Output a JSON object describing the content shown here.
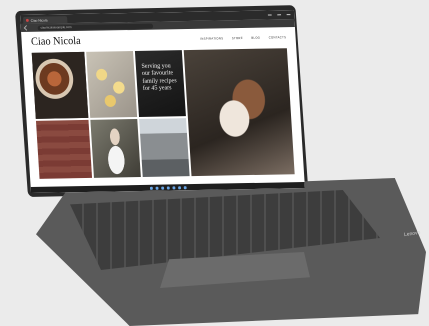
{
  "browser": {
    "tab_title": "Ciao Nicola",
    "url": "ciaonicolaexample.com"
  },
  "site": {
    "title": "Ciao Nicola",
    "nav": [
      "INSPIRATIONS",
      "STORE",
      "BLOG",
      "CONTACTS"
    ]
  },
  "hero_caption": "Serving you our favourite family recipes for 45 years",
  "device": {
    "brand": "Lenovo"
  },
  "colors": {
    "accent": "#2b2b2b",
    "taskbar_icon": "#6aa7e8"
  }
}
